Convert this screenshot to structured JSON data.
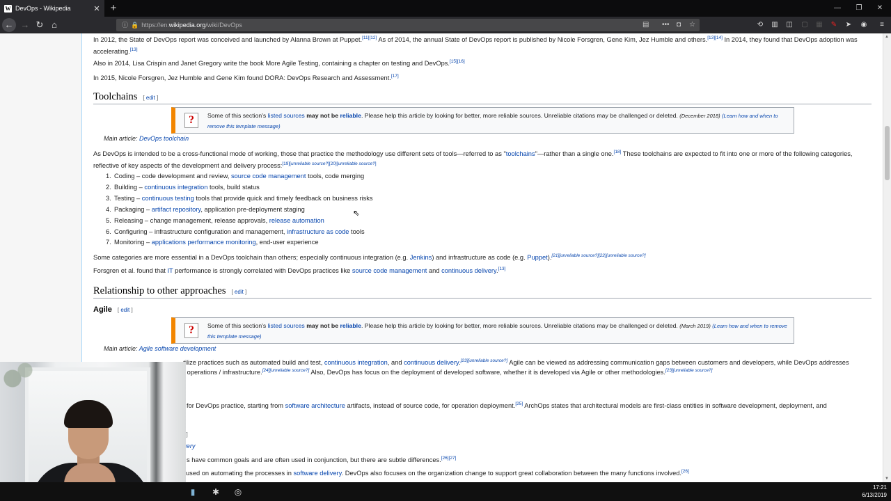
{
  "browser": {
    "tab_title": "DevOps - Wikipedia",
    "tab_favicon": "W",
    "tab_close": "✕",
    "new_tab": "+",
    "url_prefix": "https://en.",
    "url_host": "wikipedia.org",
    "url_path": "/wiki/DevOps",
    "window_controls": [
      "—",
      "❐",
      "✕"
    ]
  },
  "intro": {
    "p1_a": "In 2012, the State of DevOps report was conceived and launched by Alanna Brown at Puppet.",
    "p1_ref1": "[11][12]",
    "p1_b": " As of 2014, the annual State of DevOps report is published by Nicole Forsgren, Gene Kim, Jez Humble and others.",
    "p1_ref2": "[13][14]",
    "p1_c": " In 2014, they found that DevOps adoption was accelerating.",
    "p1_ref3": "[13]",
    "p2": "Also in 2014, Lisa Crispin and Janet Gregory write the book More Agile Testing, containing a chapter on testing and DevOps.",
    "p2_ref": "[15][16]",
    "p3": "In 2015, Nicole Forsgren, Jez Humble and Gene Kim found DORA: DevOps Research and Assessment.",
    "p3_ref": "[17]"
  },
  "toolchains": {
    "heading": "Toolchains",
    "edit_open": "[ ",
    "edit": "edit",
    "edit_close": " ]",
    "ambox": {
      "a": "Some of this section's ",
      "link1": "listed sources",
      "b": " ",
      "bold": "may not be",
      "c": " ",
      "link2": "reliable",
      "d": ". Please help this article by looking for better, more reliable sources. Unreliable citations may be challenged or deleted. ",
      "date": "(December 2018)",
      "learn": "(Learn how and when to remove this template message)"
    },
    "main_article_label": "Main article: ",
    "main_article_link": "DevOps toolchain",
    "para_a": "As DevOps is intended to be a cross-functional mode of working, those that practice the methodology use different sets of tools—referred to as \"",
    "para_link": "toolchains",
    "para_b": "\"—rather than a single one.",
    "para_ref1": "[18]",
    "para_c": " These toolchains are expected to fit into one or more of the following categories, reflective of key aspects of the development and delivery process:",
    "para_ref2": "[19][",
    "para_ref2_i": "unreliable source?",
    "para_ref3": "][20][",
    "para_ref3_i": "unreliable source?",
    "para_ref4": "]",
    "list": [
      {
        "num": "1.",
        "a": "Coding – code development and review, ",
        "link": "source code management",
        "b": " tools, code merging"
      },
      {
        "num": "2.",
        "a": "Building – ",
        "link": "continuous integration",
        "b": " tools, build status"
      },
      {
        "num": "3.",
        "a": "Testing – ",
        "link": "continuous testing",
        "b": " tools that provide quick and timely feedback on business risks"
      },
      {
        "num": "4.",
        "a": "Packaging – ",
        "link": "artifact repository",
        "b": ", application pre-deployment staging"
      },
      {
        "num": "5.",
        "a": "Releasing – change management, release approvals, ",
        "link": "release automation",
        "b": ""
      },
      {
        "num": "6.",
        "a": "Configuring – infrastructure configuration and management, ",
        "link": "infrastructure as code",
        "b": " tools"
      },
      {
        "num": "7.",
        "a": "Monitoring – ",
        "link": "applications performance monitoring",
        "b": ", end-user experience"
      }
    ],
    "p_some_a": "Some categories are more essential in a DevOps toolchain than others; especially continuous integration (e.g. ",
    "p_some_link1": "Jenkins",
    "p_some_b": ") and infrastructure as code (e.g. ",
    "p_some_link2": "Puppet",
    "p_some_c": ").",
    "p_some_ref": "[21][unreliable source?][22][unreliable source?]",
    "p_fors_a": "Forsgren et al. found that ",
    "p_fors_link0": "IT",
    "p_fors_b": " performance is strongly correlated with DevOps practices like ",
    "p_fors_link1": "source code management",
    "p_fors_c": " and ",
    "p_fors_link2": "continuous delivery",
    "p_fors_d": ".",
    "p_fors_ref": "[13]"
  },
  "relationship": {
    "heading": "Relationship to other approaches",
    "edit": "edit"
  },
  "agile": {
    "heading": "Agile",
    "edit": "edit",
    "ambox": {
      "a": "Some of this section's ",
      "link1": "listed sources",
      "b": " ",
      "bold": "may not be",
      "c": " ",
      "link2": "reliable",
      "d": ". Please help this article by looking for better, more reliable sources. Unreliable citations may be challenged or deleted. ",
      "date": "(March 2019)",
      "learn": "(Learn how and when to remove this template message)"
    },
    "main_article_label": "Main article: ",
    "main_article_link": "Agile software development",
    "l1_a": "…tilize practices such as automated build and test, ",
    "l1_link1": "continuous integration",
    "l1_b": ", and ",
    "l1_link2": "continuous delivery",
    "l1_c": ".",
    "l1_ref": "[23][unreliable source?]",
    "l1_d": " Agile can be viewed as addressing communication gaps between customers and developers, while DevOps addresses",
    "l2_a": "IT operations / infrastructure.",
    "l2_ref": "[24][unreliable source?]",
    "l2_b": " Also, DevOps has focus on the deployment of developed software, whether it is developed via Agile or other methodologies.",
    "l2_ref2": "[23][unreliable source?]",
    "l3_a": "for DevOps practice, starting from ",
    "l3_link": "software architecture",
    "l3_b": " artifacts, instead of source code, for operation deployment.",
    "l3_ref": "[25]",
    "l3_c": " ArchOps states that architectural models are first-class entities in software development, deployment, and",
    "l4": "t ]",
    "l5": "very",
    "l6_a": "s have common goals and are often used in conjunction, but there are subtle differences.",
    "l6_ref": "[26][27]",
    "l7_a": "used on automating the processes in ",
    "l7_link": "software delivery",
    "l7_b": ". DevOps also focuses on the organization change to support great collaboration between the many functions involved.",
    "l7_ref": "[26]"
  },
  "taskbar": {
    "time": "17:21",
    "date": "6/13/2019"
  }
}
